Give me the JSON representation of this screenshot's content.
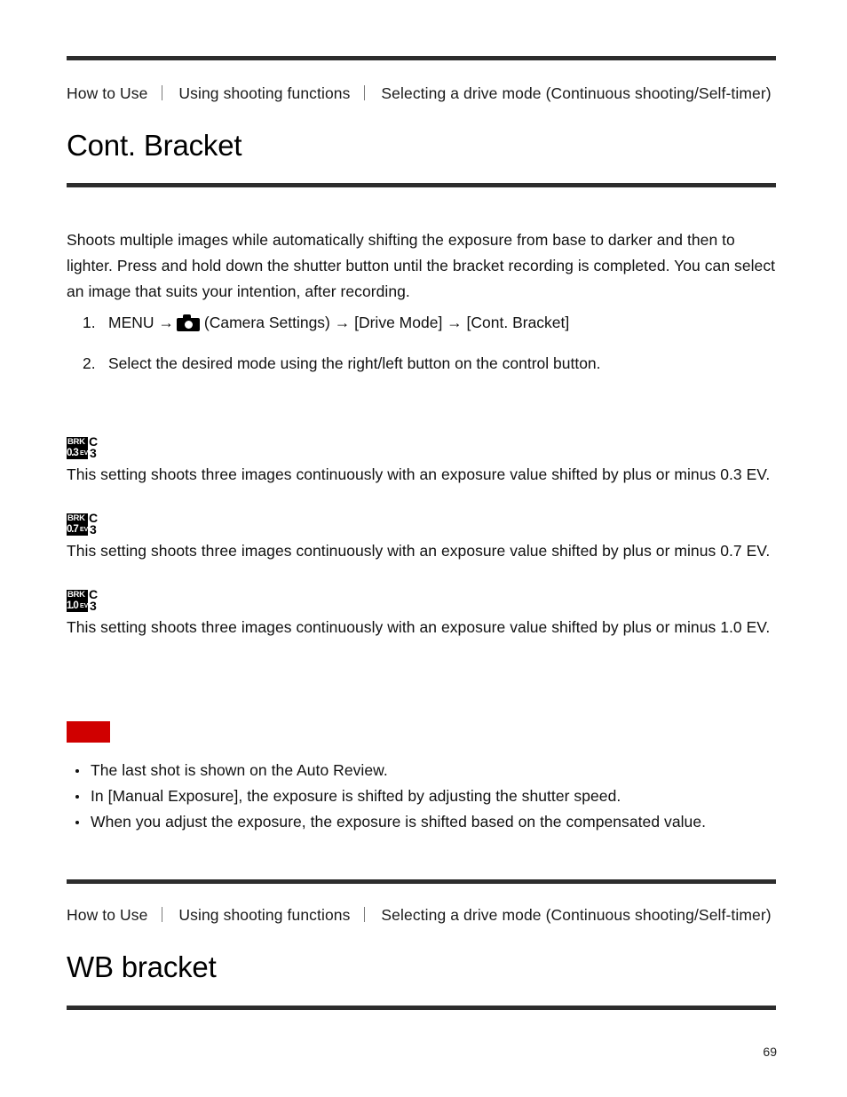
{
  "sections": [
    {
      "breadcrumb": [
        "How to Use",
        "Using shooting functions",
        "Selecting a drive mode (Continuous shooting/Self-timer)"
      ],
      "title": "Cont. Bracket"
    },
    {
      "breadcrumb": [
        "How to Use",
        "Using shooting functions",
        "Selecting a drive mode (Continuous shooting/Self-timer)"
      ],
      "title": "WB bracket"
    }
  ],
  "intro": "Shoots multiple images while automatically shifting the exposure from base to darker and then to lighter. Press and hold down the shutter button until the bracket recording is completed. You can select an image that suits your intention, after recording.",
  "steps": [
    {
      "number": "1.",
      "before_icon": "MENU →",
      "icon": "camera-icon",
      "after_icon": "(Camera Settings) → [Drive Mode] → [Cont. Bracket]"
    },
    {
      "number": "2.",
      "before_icon": "Select the desired mode using the right/left button on the control button.",
      "icon": "",
      "after_icon": ""
    }
  ],
  "modes": [
    {
      "icon": {
        "label": "BRK",
        "value": "0.3",
        "unit": "EV",
        "letter": "C",
        "count": "3"
      },
      "description": "This setting shoots three images continuously with an exposure value shifted by plus or minus 0.3 EV."
    },
    {
      "icon": {
        "label": "BRK",
        "value": "0.7",
        "unit": "EV",
        "letter": "C",
        "count": "3"
      },
      "description": "This setting shoots three images continuously with an exposure value shifted by plus or minus 0.7 EV."
    },
    {
      "icon": {
        "label": "BRK",
        "value": "1.0",
        "unit": "EV",
        "letter": "C",
        "count": "3"
      },
      "description": "This setting shoots three images continuously with an exposure value shifted by plus or minus 1.0 EV."
    }
  ],
  "note": {
    "badge_color": "#d00000",
    "badge_label": "",
    "items": [
      "The last shot is shown on the Auto Review.",
      "In [Manual Exposure], the exposure is shifted by adjusting the shutter speed.",
      "When you adjust the exposure, the exposure is shifted based on the compensated value."
    ]
  },
  "page_number": "69"
}
